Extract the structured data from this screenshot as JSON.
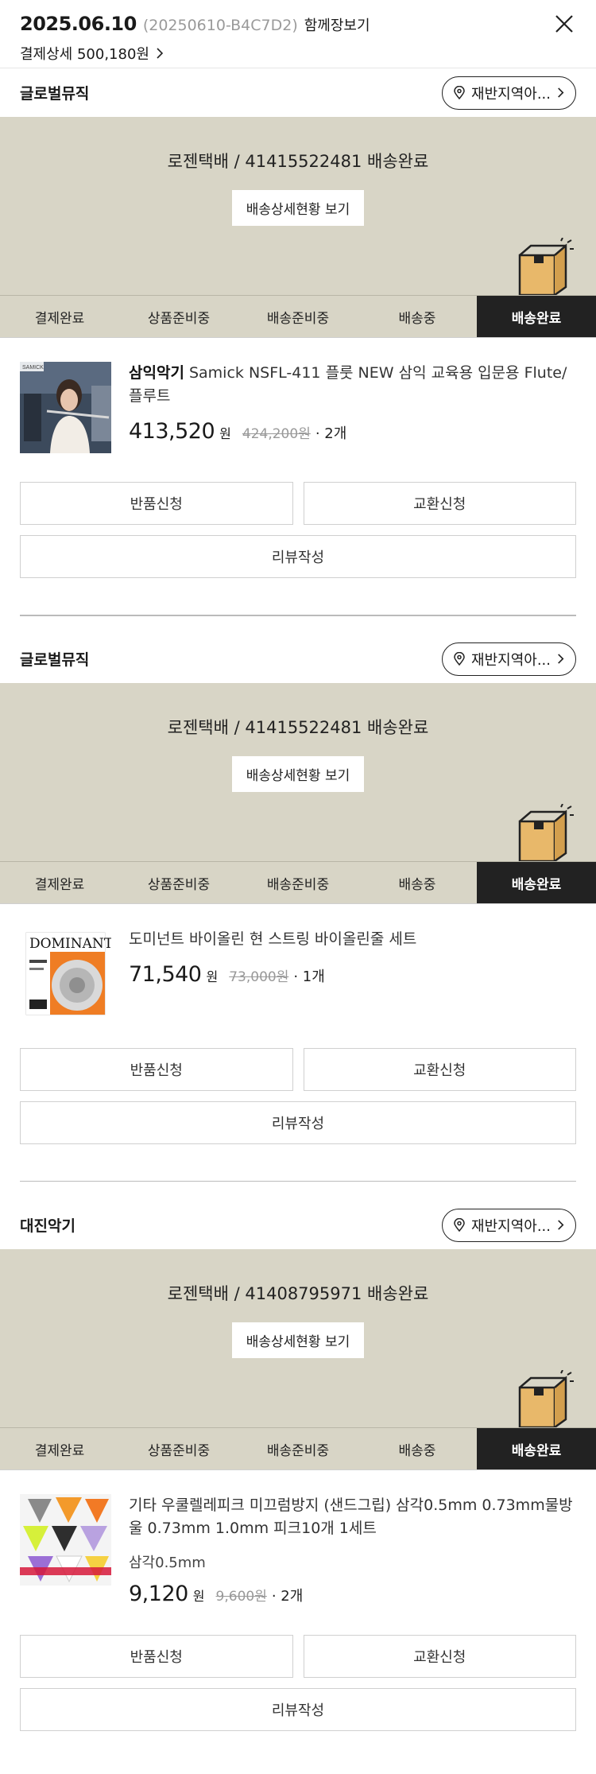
{
  "header": {
    "date": "2025.06.10",
    "order_no": "(20250610-B4C7D2)",
    "together_label": "함께장보기",
    "payment_label": "결제상세 500,180원"
  },
  "colors": {
    "banner_bg": "#d8d5c6",
    "active_step_bg": "#222222"
  },
  "steps": [
    "결제완료",
    "상품준비중",
    "배송준비중",
    "배송중",
    "배송완료"
  ],
  "buttons": {
    "track": "배송상세현황 보기",
    "return": "반품신청",
    "exchange": "교환신청",
    "review": "리뷰작성",
    "region": "재반지역아..."
  },
  "orders": [
    {
      "seller": "글로벌뮤직",
      "delivery_text": "로젠택배 / 41415522481 배송완료",
      "brand": "삼익악기",
      "name": "Samick NSFL-411 플룻 NEW 삼익 교육용 입문용 Flute/플루트",
      "option": "",
      "price": "413,520",
      "won": "원",
      "orig": "424,200원",
      "qty": "· 2개"
    },
    {
      "seller": "글로벌뮤직",
      "delivery_text": "로젠택배 / 41415522481 배송완료",
      "brand": "",
      "name": "도미넌트 바이올린 현 스트링 바이올린줄 세트",
      "option": "",
      "price": "71,540",
      "won": "원",
      "orig": "73,000원",
      "qty": "· 1개"
    },
    {
      "seller": "대진악기",
      "delivery_text": "로젠택배 / 41408795971 배송완료",
      "brand": "",
      "name": "기타 우쿨렐레피크 미끄럼방지 (샌드그립) 삼각0.5mm 0.73mm물방울 0.73mm 1.0mm 피크10개 1세트",
      "option": "삼각0.5mm",
      "price": "9,120",
      "won": "원",
      "orig": "9,600원",
      "qty": "· 2개"
    }
  ],
  "thumb_text": {
    "samick_logo": "SAMICK",
    "dominant_logo": "DOMINANT"
  }
}
